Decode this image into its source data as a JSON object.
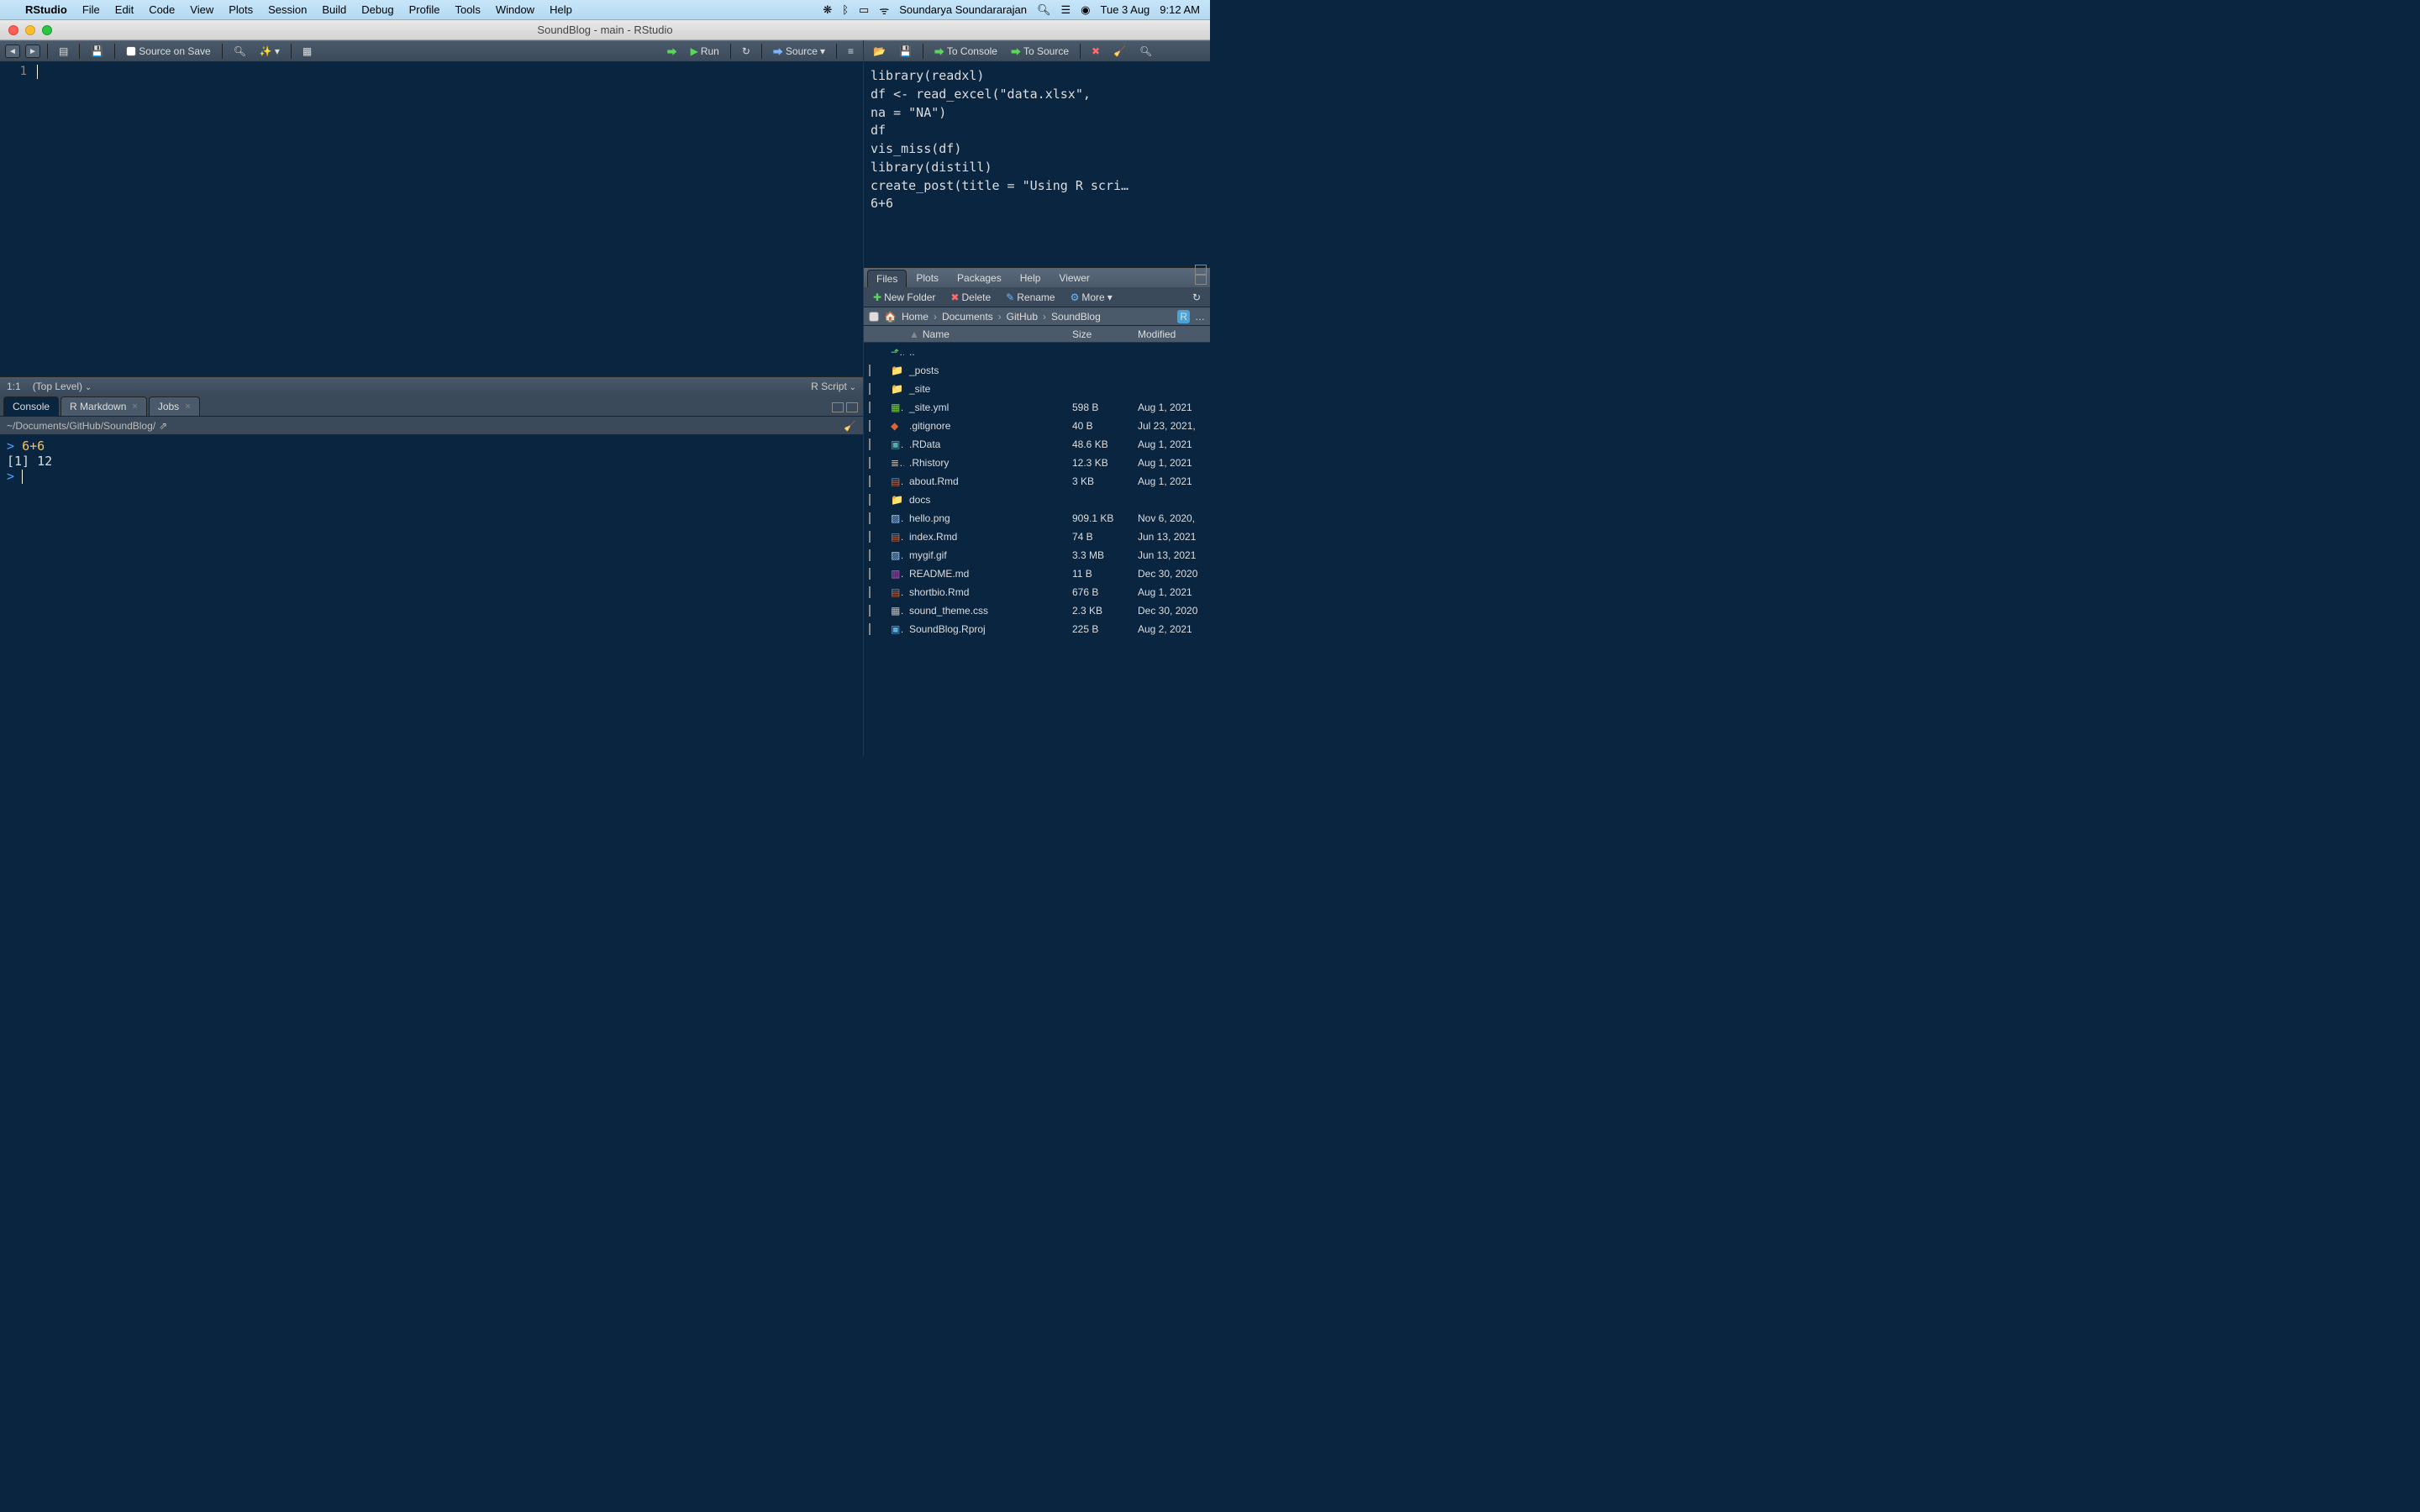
{
  "menubar": {
    "app_name": "RStudio",
    "items": [
      "File",
      "Edit",
      "Code",
      "View",
      "Plots",
      "Session",
      "Build",
      "Debug",
      "Profile",
      "Tools",
      "Window",
      "Help"
    ],
    "user": "Soundarya Soundararajan",
    "date": "Tue 3 Aug",
    "time": "9:12 AM"
  },
  "window_title": "SoundBlog - main - RStudio",
  "editor_toolbar": {
    "source_on_save": "Source on Save",
    "run": "Run",
    "source": "Source"
  },
  "editor": {
    "line_number": "1"
  },
  "editor_status": {
    "pos": "1:1",
    "scope": "(Top Level)",
    "type": "R Script"
  },
  "console": {
    "tabs": [
      "Console",
      "R Markdown",
      "Jobs"
    ],
    "path": "~/Documents/GitHub/SoundBlog/",
    "lines": [
      {
        "prompt": ">",
        "cmd": "6+6"
      },
      {
        "text": "[1] 12"
      },
      {
        "prompt": ">",
        "cmd": ""
      }
    ]
  },
  "right_toolbar": {
    "to_console": "To Console",
    "to_source": "To Source"
  },
  "history_lines": [
    "library(readxl)",
    "df <- read_excel(\"data.xlsx\",",
    "na = \"NA\")",
    "df",
    "vis_miss(df)",
    "library(distill)",
    "create_post(title = \"Using R scri…",
    "6+6"
  ],
  "pane_tabs": [
    "Files",
    "Plots",
    "Packages",
    "Help",
    "Viewer"
  ],
  "files_toolbar": {
    "new_folder": "New Folder",
    "delete": "Delete",
    "rename": "Rename",
    "more": "More"
  },
  "breadcrumb": [
    "Home",
    "Documents",
    "GitHub",
    "SoundBlog"
  ],
  "files_header": {
    "name": "Name",
    "size": "Size",
    "modified": "Modified"
  },
  "files": [
    {
      "icon": "up",
      "name": "..",
      "size": "",
      "mod": ""
    },
    {
      "icon": "folder",
      "name": "_posts",
      "size": "",
      "mod": ""
    },
    {
      "icon": "folder",
      "name": "_site",
      "size": "",
      "mod": ""
    },
    {
      "icon": "yml",
      "name": "_site.yml",
      "size": "598 B",
      "mod": "Aug 1, 2021"
    },
    {
      "icon": "git",
      "name": ".gitignore",
      "size": "40 B",
      "mod": "Jul 23, 2021,"
    },
    {
      "icon": "rdata",
      "name": ".RData",
      "size": "48.6 KB",
      "mod": "Aug 1, 2021"
    },
    {
      "icon": "rhist",
      "name": ".Rhistory",
      "size": "12.3 KB",
      "mod": "Aug 1, 2021"
    },
    {
      "icon": "rmd",
      "name": "about.Rmd",
      "size": "3 KB",
      "mod": "Aug 1, 2021"
    },
    {
      "icon": "folder",
      "name": "docs",
      "size": "",
      "mod": ""
    },
    {
      "icon": "img",
      "name": "hello.png",
      "size": "909.1 KB",
      "mod": "Nov 6, 2020,"
    },
    {
      "icon": "rmd",
      "name": "index.Rmd",
      "size": "74 B",
      "mod": "Jun 13, 2021"
    },
    {
      "icon": "img",
      "name": "mygif.gif",
      "size": "3.3 MB",
      "mod": "Jun 13, 2021"
    },
    {
      "icon": "md",
      "name": "README.md",
      "size": "11 B",
      "mod": "Dec 30, 2020"
    },
    {
      "icon": "rmd",
      "name": "shortbio.Rmd",
      "size": "676 B",
      "mod": "Aug 1, 2021"
    },
    {
      "icon": "css",
      "name": "sound_theme.css",
      "size": "2.3 KB",
      "mod": "Dec 30, 2020"
    },
    {
      "icon": "rproj",
      "name": "SoundBlog.Rproj",
      "size": "225 B",
      "mod": "Aug 2, 2021"
    }
  ]
}
